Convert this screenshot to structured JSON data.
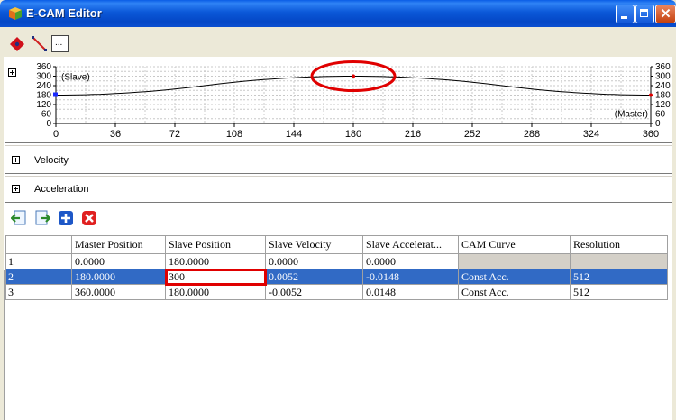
{
  "window": {
    "title": "E-CAM Editor"
  },
  "toolbar": {
    "tools": [
      "point-tool-icon",
      "line-tool-icon",
      "more-options-icon"
    ],
    "more_label": "..."
  },
  "position_chart": {
    "y_ticks_left": [
      "360",
      "300",
      "240",
      "180",
      "120",
      "60",
      "0"
    ],
    "y_ticks_right": [
      "360",
      "300",
      "240",
      "180",
      "120",
      "60",
      "0"
    ],
    "x_ticks": [
      "0",
      "36",
      "72",
      "108",
      "144",
      "180",
      "216",
      "252",
      "288",
      "324",
      "360"
    ],
    "slave_label": "(Slave)",
    "master_label": "(Master)",
    "collapse_symbol": "−"
  },
  "chart_data": {
    "type": "line",
    "series": [
      {
        "x": [
          0,
          180,
          360
        ],
        "y": [
          180,
          300,
          180
        ]
      }
    ],
    "xlim": [
      0,
      360
    ],
    "ylim": [
      0,
      360
    ],
    "xlabel": "(Master)",
    "ylabel": "(Slave)"
  },
  "sections": {
    "velocity": "Velocity",
    "acceleration": "Acceleration"
  },
  "table": {
    "headers": [
      "",
      "Master Position",
      "Slave Position",
      "Slave Velocity",
      "Slave Accelerat...",
      "CAM Curve",
      "Resolution"
    ],
    "rows": [
      [
        "1",
        "0.0000",
        "180.0000",
        "0.0000",
        "0.0000",
        "",
        ""
      ],
      [
        "2",
        "180.0000",
        "300",
        "0.0052",
        "-0.0148",
        "Const Acc.",
        "512"
      ],
      [
        "3",
        "360.0000",
        "180.0000",
        "-0.0052",
        "0.0148",
        "Const Acc.",
        "512"
      ]
    ]
  },
  "colors": {
    "accent": "#316ac5",
    "highlight": "#e00000"
  }
}
